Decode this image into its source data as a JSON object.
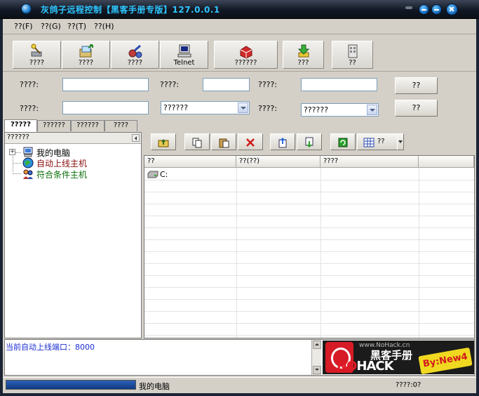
{
  "window": {
    "title": "灰鸽子远程控制【黑客手册专版】127.0.0.1"
  },
  "menu": {
    "items": [
      "??(F)",
      "??(G)",
      "??(T)",
      "??(H)"
    ]
  },
  "toolbar": {
    "buttons": [
      {
        "label": "????",
        "icon": "wand-icon"
      },
      {
        "label": "????",
        "icon": "folder-arrow-icon"
      },
      {
        "label": "????",
        "icon": "tools-icon"
      },
      {
        "label": "Telnet",
        "icon": "terminal-computer-icon"
      },
      {
        "label": "??????",
        "icon": "remove-package-icon"
      },
      {
        "label": "???",
        "icon": "download-arrow-icon"
      },
      {
        "label": "??",
        "icon": "building-icon"
      }
    ]
  },
  "form": {
    "row1": {
      "label1": "????:",
      "value1": "",
      "label2": "????:",
      "value2": "",
      "label3": "????:",
      "value3": "",
      "button": "??"
    },
    "row2": {
      "label1": "????:",
      "value1": "",
      "select1": "??????",
      "label2": "????:",
      "select2": "??????",
      "button": "??"
    }
  },
  "tabs": [
    "?????",
    "??????",
    "??????",
    "????"
  ],
  "left_pane": {
    "header": "??????",
    "tree": [
      {
        "label": "我的电脑",
        "color": "#000000",
        "icon": "computer-icon"
      },
      {
        "label": "自动上线主机",
        "color": "#8a0d0d",
        "icon": "globe-icon"
      },
      {
        "label": "符合条件主机",
        "color": "#0a6e0a",
        "icon": "users-icon"
      }
    ]
  },
  "right_toolbar": {
    "view_label": "??"
  },
  "file_list": {
    "columns": [
      "??",
      "??(??)",
      "????",
      ""
    ],
    "rows": [
      {
        "name": "C:"
      }
    ]
  },
  "log": {
    "text": "当前自动上线端口：8000"
  },
  "banner": {
    "site": "www.NoHack.cn",
    "title": "黑客手册",
    "logo_no": "NO",
    "logo_hack": "HACK",
    "by": "By:New4"
  },
  "status": {
    "progress": 1.0,
    "text": "我的电脑",
    "right": "????:0?"
  },
  "colors": {
    "title": "#2ec6ff",
    "log_text": "#1a2cd0",
    "progress": "#1a4aa0"
  }
}
